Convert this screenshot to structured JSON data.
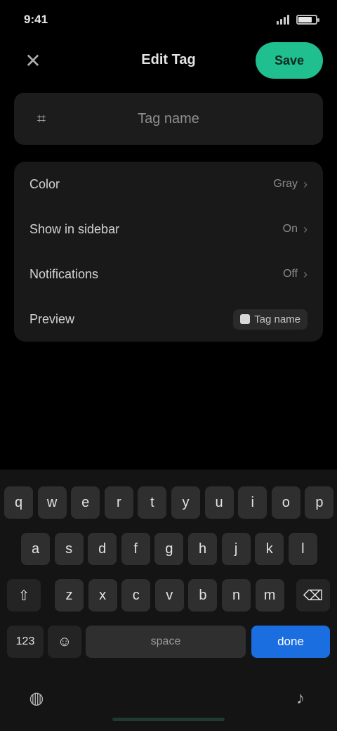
{
  "status_bar": {
    "time": "9:41",
    "battery_level": 0.8,
    "signal_bars": 4
  },
  "header": {
    "close_icon": "close-icon",
    "title": "Edit Tag",
    "save_label": "Save",
    "accent_color": "#1fbf8f"
  },
  "name_field": {
    "icon": "tag-icon",
    "placeholder": "Tag name",
    "value": ""
  },
  "settings": [
    {
      "label": "Color",
      "value": "Gray"
    },
    {
      "label": "Show in sidebar",
      "value": "On"
    },
    {
      "label": "Notifications",
      "value": "Off"
    },
    {
      "label": "Preview",
      "value": "Tag name"
    }
  ],
  "keyboard": {
    "row1": [
      "q",
      "w",
      "e",
      "r",
      "t",
      "y",
      "u",
      "i",
      "o",
      "p"
    ],
    "row2": [
      "a",
      "s",
      "d",
      "f",
      "g",
      "h",
      "j",
      "k",
      "l"
    ],
    "row3": [
      "z",
      "x",
      "c",
      "v",
      "b",
      "n",
      "m"
    ],
    "shift_icon": "shift-icon",
    "backspace_icon": "backspace-icon",
    "numbers_label": "123",
    "emoji_icon": "emoji-icon",
    "space_label": "space",
    "return_label": "done",
    "globe_icon": "globe-icon",
    "mic_icon": "mic-icon",
    "return_color": "#1a6ee0"
  }
}
